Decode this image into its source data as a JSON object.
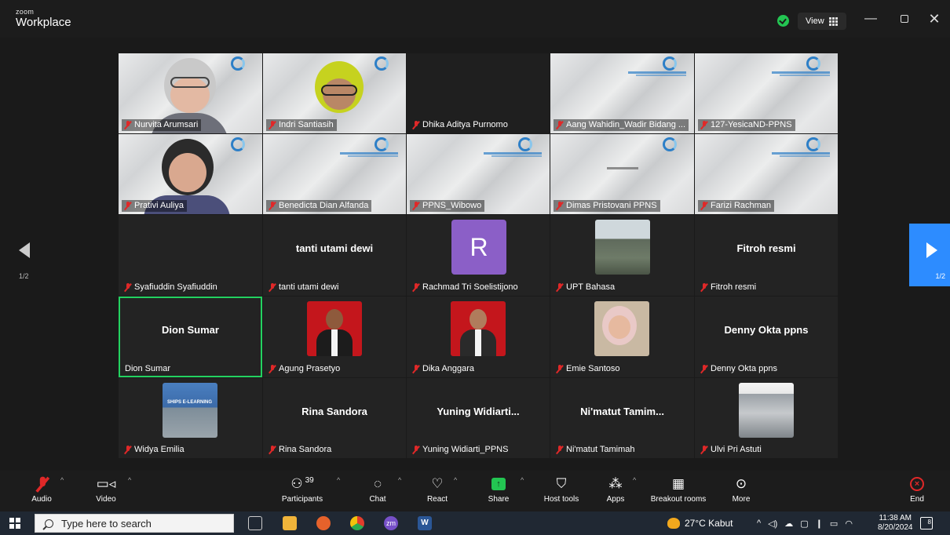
{
  "titlebar": {
    "brand_small": "zoom",
    "brand_big": "Workplace",
    "view_label": "View",
    "colors": {
      "shield": "#23c552",
      "bg": "#1c1c1c"
    }
  },
  "pager": {
    "left_label": "1/2",
    "right_label": "1/2",
    "accent": "#2d8cff"
  },
  "tiles": [
    {
      "name": "Nurvita Arumsari",
      "muted": true
    },
    {
      "name": "Indri Santiasih",
      "muted": true
    },
    {
      "name": "Dhika Aditya Purnomo",
      "muted": true
    },
    {
      "name": "Aang Wahidin_Wadir Bidang ...",
      "muted": true
    },
    {
      "name": "127-YesicaND-PPNS",
      "muted": true
    },
    {
      "name": "Prativi Auliya",
      "muted": true
    },
    {
      "name": "Benedicta Dian Alfanda",
      "muted": true
    },
    {
      "name": "PPNS_Wibowo",
      "muted": true
    },
    {
      "name": "Dimas Pristovani PPNS",
      "muted": true
    },
    {
      "name": "Farizi Rachman",
      "muted": true
    },
    {
      "name": "Syafiuddin Syafiuddin",
      "muted": true
    },
    {
      "name": "tanti utami dewi",
      "display": "tanti utami dewi",
      "muted": true
    },
    {
      "name": "Rachmad Tri Soelistijono",
      "avatar_letter": "R",
      "muted": true
    },
    {
      "name": "UPT Bahasa",
      "muted": true
    },
    {
      "name": "Fitroh resmi",
      "display": "Fitroh resmi",
      "muted": true
    },
    {
      "name": "Dion Sumar",
      "display": "Dion Sumar",
      "muted": false,
      "active": true
    },
    {
      "name": "Agung Prasetyo",
      "muted": true
    },
    {
      "name": "Dika Anggara",
      "muted": true
    },
    {
      "name": "Emie Santoso",
      "muted": true
    },
    {
      "name": "Denny Okta ppns",
      "display": "Denny Okta ppns",
      "muted": true
    },
    {
      "name": "Widya Emilia",
      "muted": true,
      "photo_caption": "SHIPS E-LEARNING"
    },
    {
      "name": "Rina Sandora",
      "display": "Rina Sandora",
      "muted": true
    },
    {
      "name": "Yuning Widiarti_PPNS",
      "display": "Yuning  Widiarti...",
      "muted": true
    },
    {
      "name": "Ni'matut Tamimah",
      "display": "Ni'matut  Tamim...",
      "muted": true
    },
    {
      "name": "Ulvi Pri Astuti",
      "muted": true
    }
  ],
  "toolbar": {
    "audio": "Audio",
    "video": "Video",
    "participants": "Participants",
    "participants_count": "39",
    "chat": "Chat",
    "react": "React",
    "share": "Share",
    "host_tools": "Host tools",
    "apps": "Apps",
    "breakout": "Breakout rooms",
    "more": "More",
    "end": "End",
    "colors": {
      "share": "#23c552",
      "end": "#e02828"
    }
  },
  "taskbar": {
    "search_placeholder": "Type here to search",
    "weather": "27°C  Kabut",
    "time": "11:38 AM",
    "date": "8/20/2024",
    "notif_count": "8"
  }
}
